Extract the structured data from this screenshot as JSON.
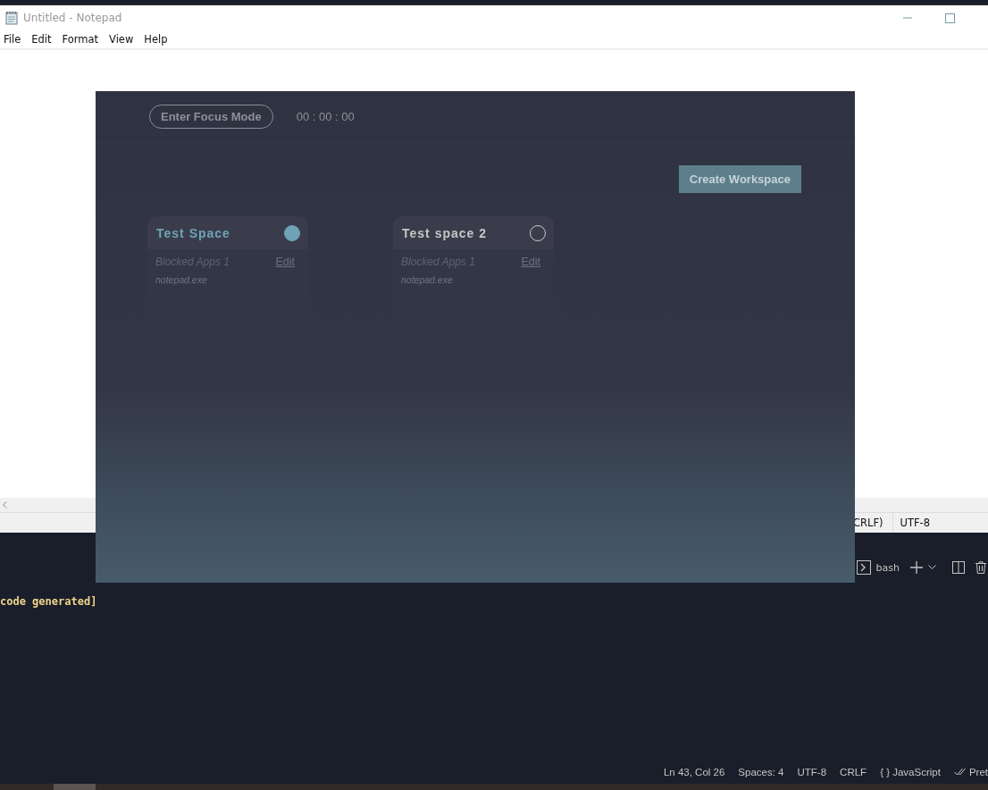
{
  "editor": {
    "terminal": {
      "shell": "bash",
      "output": "code generated]"
    },
    "status_bar": [
      "Ln 43, Col 26",
      "Spaces: 4",
      "UTF-8",
      "CRLF",
      "{ } JavaScript",
      "Pret"
    ]
  },
  "notepad": {
    "title": "Untitled - Notepad",
    "menu": [
      "File",
      "Edit",
      "Format",
      "View",
      "Help"
    ],
    "status_bar": [
      "CRLF)",
      "UTF-8"
    ]
  },
  "app": {
    "focus_button": "Enter Focus Mode",
    "timer": "00 : 00 : 00",
    "create_button": "Create Workspace",
    "workspaces": [
      {
        "name": "Test Space",
        "selected": true,
        "blocked_label": "Blocked Apps 1",
        "edit": "Edit",
        "apps": [
          "notepad.exe"
        ]
      },
      {
        "name": "Test space 2",
        "selected": false,
        "blocked_label": "Blocked Apps 1",
        "edit": "Edit",
        "apps": [
          "notepad.exe"
        ]
      }
    ]
  }
}
